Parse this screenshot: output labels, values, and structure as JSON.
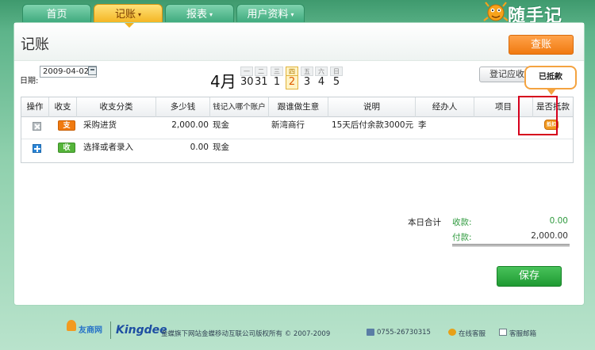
{
  "nav": {
    "tabs": [
      {
        "label": "首页",
        "active": false,
        "caret": false
      },
      {
        "label": "记账",
        "active": true,
        "caret": true
      },
      {
        "label": "报表",
        "active": false,
        "caret": true
      },
      {
        "label": "用户资料",
        "active": false,
        "caret": true
      }
    ],
    "caret_glyph": "▾",
    "logo_text": "随手记"
  },
  "header": {
    "title": "记账",
    "query_button": "查账"
  },
  "date": {
    "label": "日期:",
    "value": "2009-04-02",
    "month": "4月",
    "week": [
      {
        "weekday": "一",
        "day": "30",
        "today": false
      },
      {
        "weekday": "二",
        "day": "31",
        "today": false
      },
      {
        "weekday": "三",
        "day": "1",
        "today": false
      },
      {
        "weekday": "四",
        "day": "2",
        "today": true
      },
      {
        "weekday": "五",
        "day": "3",
        "today": false
      },
      {
        "weekday": "六",
        "day": "4",
        "today": false
      },
      {
        "weekday": "日",
        "day": "5",
        "today": false
      }
    ]
  },
  "actions": {
    "register_receivable": "登记应收",
    "tooltip": "已抵款"
  },
  "table": {
    "headers": [
      "操作",
      "收支",
      "收支分类",
      "多少钱",
      "钱记入哪个账户",
      "跟谁做生意",
      "说明",
      "经办人",
      "项目",
      "是否抵款"
    ],
    "rows": [
      {
        "type": "支",
        "category": "采购进货",
        "amount": "2,000.00",
        "account": "现金",
        "partner": "新湾商行",
        "note": "15天后付余款3000元",
        "handler": "李",
        "project": "",
        "offset_icon": "抵扣"
      },
      {
        "type": "收",
        "category": "选择或者录入",
        "amount": "0.00",
        "account": "现金",
        "partner": "",
        "note": "",
        "handler": "",
        "project": ""
      }
    ]
  },
  "totals": {
    "title": "本日合计",
    "income_label": "收款:",
    "income_value": "0.00",
    "expense_label": "付款:",
    "expense_value": "2,000.00"
  },
  "save_button": "保存",
  "footer": {
    "brand1": "友商网",
    "brand2": "Kingdee",
    "copyright": "金蝶旗下网站金蝶移动互联公司版权所有 © 2007-2009",
    "phone": "0755-26730315",
    "online_service": "在线客服",
    "email_service": "客服邮箱"
  },
  "colors": {
    "accent_orange": "#f07a10",
    "accent_green": "#1f9a33",
    "highlight_red": "#d6001c"
  }
}
